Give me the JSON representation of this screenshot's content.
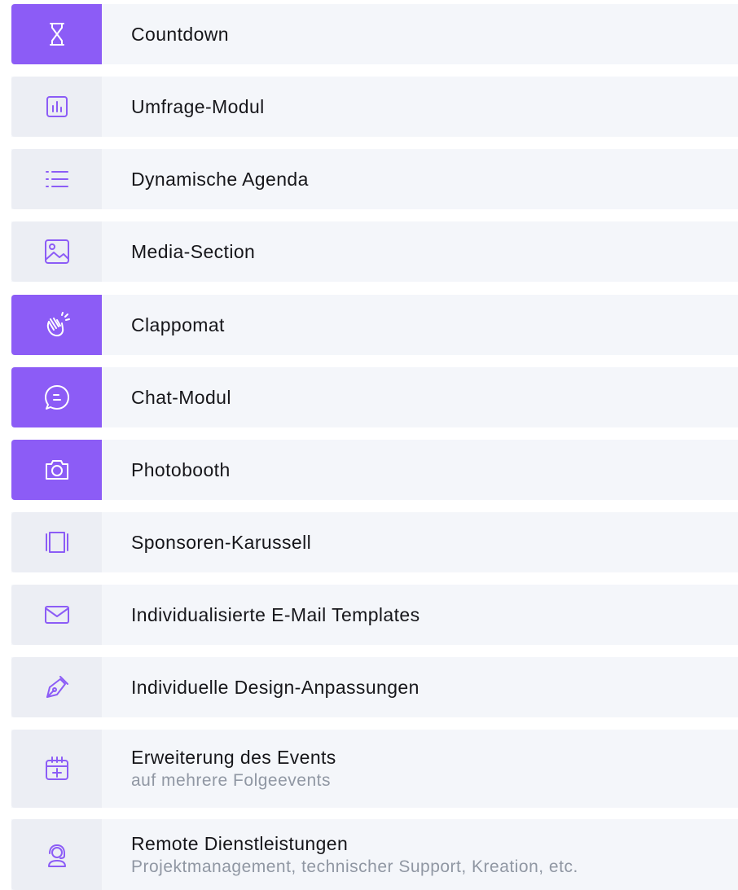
{
  "accent_color": "#8c5cf6",
  "items": [
    {
      "label": "Countdown",
      "icon": "hourglass-icon",
      "active": true
    },
    {
      "label": "Umfrage-Modul",
      "icon": "bar-chart-icon",
      "active": false
    },
    {
      "label": "Dynamische Agenda",
      "icon": "list-icon",
      "active": false
    },
    {
      "label": "Media-Section",
      "icon": "image-icon",
      "active": false
    },
    {
      "label": "Clappomat",
      "icon": "clapping-hands-icon",
      "active": true
    },
    {
      "label": "Chat-Modul",
      "icon": "chat-bubble-icon",
      "active": true
    },
    {
      "label": "Photobooth",
      "icon": "camera-icon",
      "active": true
    },
    {
      "label": "Sponsoren-Karussell",
      "icon": "carousel-icon",
      "active": false
    },
    {
      "label": "Individualisierte E-Mail Templates",
      "icon": "mail-icon",
      "active": false
    },
    {
      "label": "Individuelle Design-Anpassungen",
      "icon": "pen-nib-icon",
      "active": false
    },
    {
      "label": "Erweiterung des Events",
      "sublabel": "auf mehrere Folgeevents",
      "icon": "calendar-plus-icon",
      "active": false
    },
    {
      "label": "Remote Dienstleistungen",
      "sublabel": "Projektmanagement, technischer Support, Kreation, etc.",
      "icon": "headset-user-icon",
      "active": false
    }
  ]
}
